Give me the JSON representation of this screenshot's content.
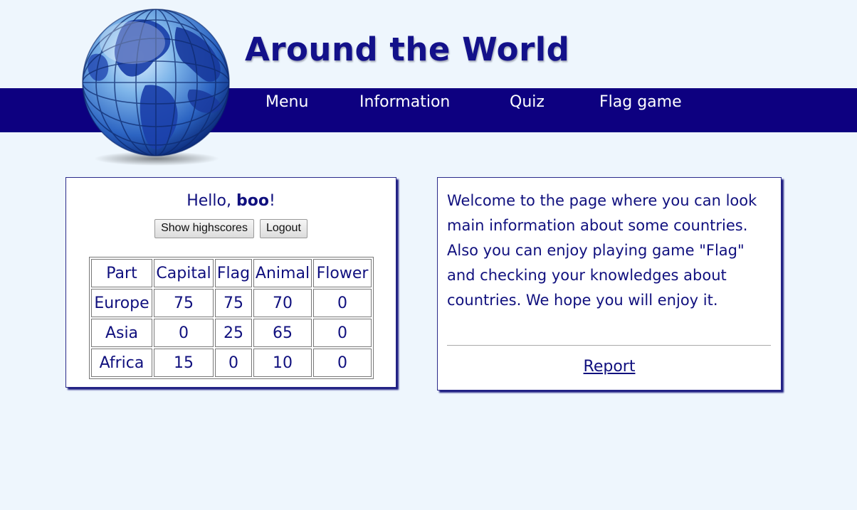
{
  "header": {
    "title": "Around the World"
  },
  "nav": {
    "items": [
      "Menu",
      "Information",
      "Quiz",
      "Flag game"
    ]
  },
  "user_panel": {
    "greeting_prefix": "Hello, ",
    "username": "boo",
    "greeting_suffix": "!",
    "show_highscores_label": "Show highscores",
    "logout_label": "Logout"
  },
  "scores": {
    "headers": [
      "Part",
      "Capital",
      "Flag",
      "Animal",
      "Flower"
    ],
    "rows": [
      [
        "Europe",
        "75",
        "75",
        "70",
        "0"
      ],
      [
        "Asia",
        "0",
        "25",
        "65",
        "0"
      ],
      [
        "Africa",
        "15",
        "0",
        "10",
        "0"
      ]
    ]
  },
  "info_panel": {
    "welcome_text": "Welcome to the page where you can look main information about some countries. Also you can enjoy playing game \"Flag\" and checking your knowledges about countries. We hope you will enjoy it.",
    "report_label": "Report"
  },
  "colors": {
    "background": "#eef6fd",
    "navbar": "#0d0080",
    "text": "#10107e"
  },
  "icons": {
    "logo": "globe-icon"
  }
}
